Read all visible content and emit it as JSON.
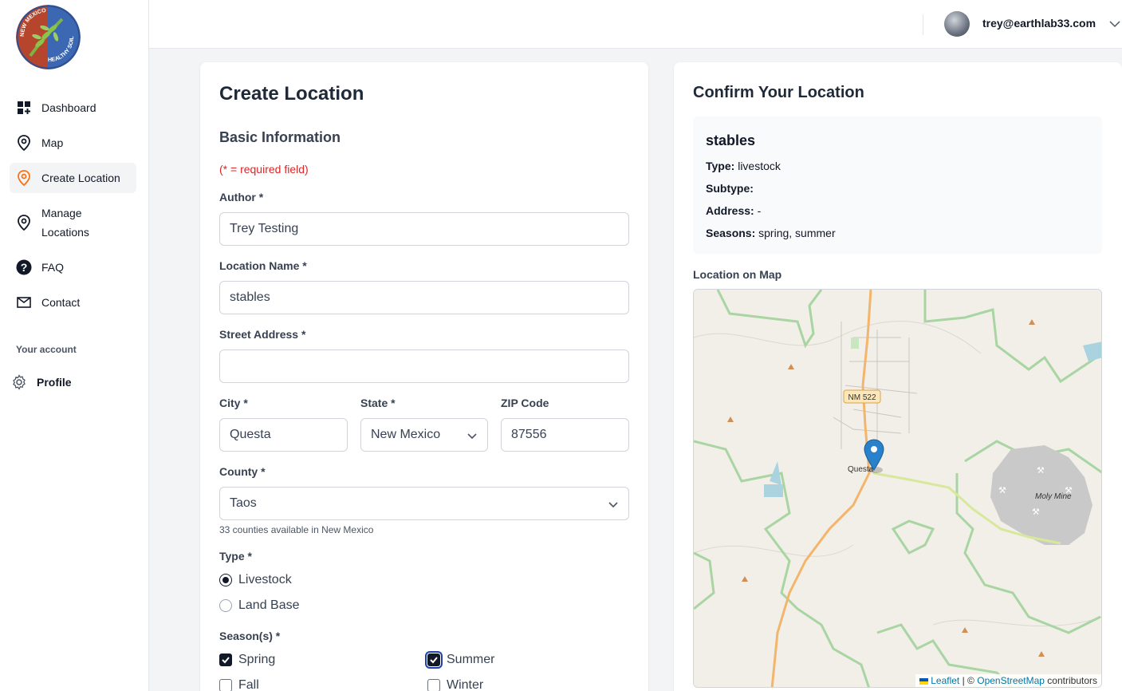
{
  "sidebar": {
    "logo": {
      "top_text": "NEW MEXICO",
      "bottom_text": "HEALTHY SOIL"
    },
    "items": [
      {
        "label": "Dashboard",
        "icon": "dashboard-icon"
      },
      {
        "label": "Map",
        "icon": "map-pin-icon"
      },
      {
        "label": "Create Location",
        "icon": "map-pin-icon",
        "active": true
      },
      {
        "label": "Manage Locations",
        "icon": "map-pin-icon"
      },
      {
        "label": "FAQ",
        "icon": "question-circle-icon"
      },
      {
        "label": "Contact",
        "icon": "envelope-icon"
      }
    ],
    "account_label": "Your account",
    "profile_label": "Profile"
  },
  "header": {
    "user_email": "trey@earthlab33.com"
  },
  "form": {
    "title": "Create Location",
    "section": "Basic Information",
    "required_note": "(* = required field)",
    "author": {
      "label": "Author *",
      "value": "Trey Testing"
    },
    "location_name": {
      "label": "Location Name *",
      "value": "stables"
    },
    "street_address": {
      "label": "Street Address *",
      "value": ""
    },
    "city": {
      "label": "City *",
      "value": "Questa"
    },
    "state": {
      "label": "State *",
      "value": "New Mexico"
    },
    "zip": {
      "label": "ZIP Code",
      "value": "87556"
    },
    "county": {
      "label": "County *",
      "value": "Taos",
      "hint": "33 counties available in New Mexico"
    },
    "type": {
      "label": "Type *",
      "options": [
        "Livestock",
        "Land Base"
      ],
      "selected": "Livestock"
    },
    "seasons": {
      "label": "Season(s) *",
      "options": [
        "Spring",
        "Summer",
        "Fall",
        "Winter"
      ],
      "checked": [
        "Spring",
        "Summer"
      ]
    }
  },
  "confirm": {
    "title": "Confirm Your Location",
    "name": "stables",
    "type_label": "Type:",
    "type_value": "livestock",
    "subtype_label": "Subtype:",
    "subtype_value": "",
    "address_label": "Address:",
    "address_value": "-",
    "seasons_label": "Seasons:",
    "seasons_value": "spring, summer",
    "map_label": "Location on Map",
    "map": {
      "road_label": "NM 522",
      "town_label": "Questa",
      "mine_label": "Moly Mine",
      "attribution_leaflet": "Leaflet",
      "attribution_sep": "| ©",
      "attribution_osm": "OpenStreetMap",
      "attribution_suffix": "contributors"
    }
  },
  "colors": {
    "accent": "#111827",
    "required": "#dc2626",
    "active_pin": "#f97316",
    "marker": "#2a81cb"
  }
}
